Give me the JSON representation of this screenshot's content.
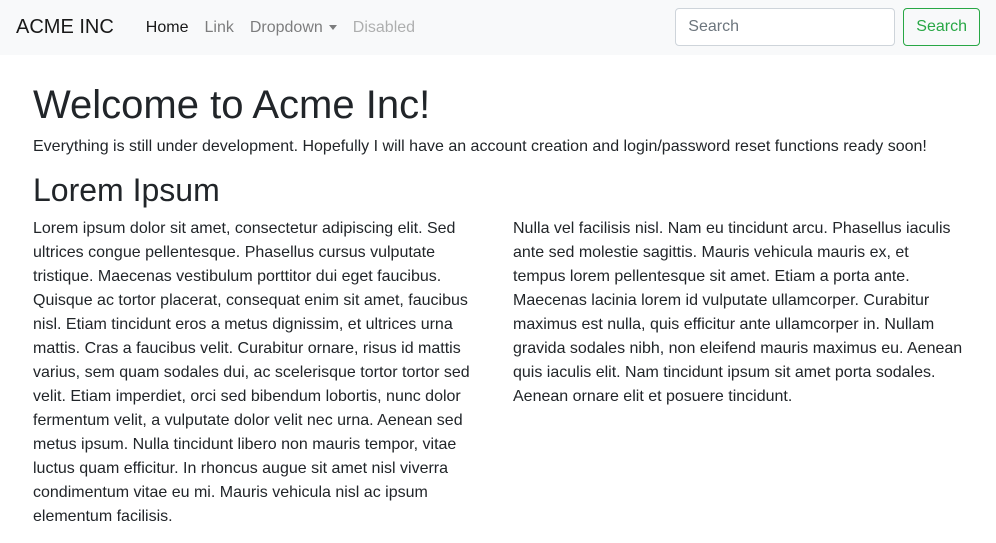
{
  "navbar": {
    "brand": "ACME INC",
    "links": {
      "home": "Home",
      "link": "Link",
      "dropdown": "Dropdown",
      "disabled": "Disabled"
    },
    "search": {
      "placeholder": "Search",
      "value": "",
      "button_label": "Search"
    }
  },
  "main": {
    "title": "Welcome to Acme Inc!",
    "lead": "Everything is still under development. Hopefully I will have an account creation and login/password reset functions ready soon!",
    "section_title": "Lorem Ipsum",
    "paragraphs": [
      "Lorem ipsum dolor sit amet, consectetur adipiscing elit. Sed ultrices congue pellentesque. Phasellus cursus vulputate tristique. Maecenas vestibulum porttitor dui eget faucibus. Quisque ac tortor placerat, consequat enim sit amet, faucibus nisl. Etiam tincidunt eros a metus dignissim, et ultrices urna mattis. Cras a faucibus velit. Curabitur ornare, risus id mattis varius, sem quam sodales dui, ac scelerisque tortor tortor sed velit. Etiam imperdiet, orci sed bibendum lobortis, nunc dolor fermentum velit, a vulputate dolor velit nec urna. Aenean sed metus ipsum. Nulla tincidunt libero non mauris tempor, vitae luctus quam efficitur. In rhoncus augue sit amet nisl viverra condimentum vitae eu mi. Mauris vehicula nisl ac ipsum elementum facilisis.",
      "Nulla vel facilisis nisl. Nam eu tincidunt arcu. Phasellus iaculis ante sed molestie sagittis. Mauris vehicula mauris ex, et tempus lorem pellentesque sit amet. Etiam a porta ante. Maecenas lacinia lorem id vulputate ullamcorper. Curabitur maximus est nulla, quis efficitur ante ullamcorper in. Nullam gravida sodales nibh, non eleifend mauris maximus eu. Aenean quis iaculis elit. Nam tincidunt ipsum sit amet porta sodales. Aenean ornare elit et posuere tincidunt."
    ]
  },
  "colors": {
    "navbar_bg": "#f8f9fa",
    "success": "#28a745",
    "text": "#212529"
  }
}
